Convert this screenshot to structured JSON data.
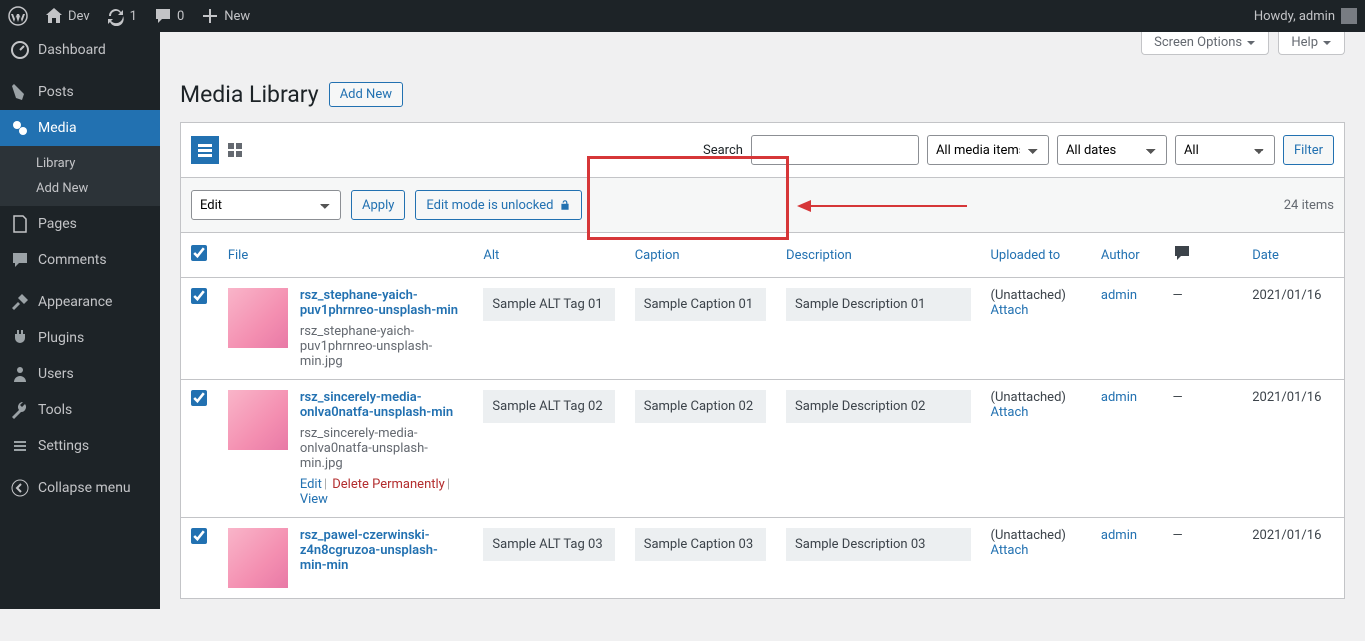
{
  "adminbar": {
    "site": "Dev",
    "updates": "1",
    "comments": "0",
    "new": "New",
    "howdy": "Howdy, admin"
  },
  "menu": {
    "dashboard": "Dashboard",
    "posts": "Posts",
    "media": "Media",
    "media_sub": {
      "library": "Library",
      "addnew": "Add New"
    },
    "pages": "Pages",
    "comments": "Comments",
    "appearance": "Appearance",
    "plugins": "Plugins",
    "users": "Users",
    "tools": "Tools",
    "settings": "Settings",
    "collapse": "Collapse menu"
  },
  "screen_meta": {
    "options": "Screen Options",
    "help": "Help"
  },
  "page": {
    "title": "Media Library",
    "add_new": "Add New"
  },
  "filters": {
    "search_label": "Search",
    "media_items": "All media items",
    "dates": "All dates",
    "all": "All",
    "filter": "Filter"
  },
  "bulk": {
    "action": "Edit",
    "apply": "Apply",
    "edit_mode": "Edit mode is unlocked",
    "count": "24 items"
  },
  "columns": {
    "file": "File",
    "alt": "Alt",
    "caption": "Caption",
    "description": "Description",
    "uploaded_to": "Uploaded to",
    "author": "Author",
    "date": "Date"
  },
  "rows": [
    {
      "title": "rsz_stephane-yaich-puv1phrnreo-unsplash-min",
      "filename": "rsz_stephane-yaich-puv1phrnreo-unsplash-min.jpg",
      "alt": "Sample ALT Tag 01",
      "caption": "Sample Caption 01",
      "description": "Sample Description 01",
      "uploaded": "(Unattached)",
      "attach": "Attach",
      "author": "admin",
      "comments": "—",
      "date": "2021/01/16",
      "show_actions": false
    },
    {
      "title": "rsz_sincerely-media-onlva0natfa-unsplash-min",
      "filename": "rsz_sincerely-media-onlva0natfa-unsplash-min.jpg",
      "alt": "Sample ALT Tag 02",
      "caption": "Sample Caption 02",
      "description": "Sample Description 02",
      "uploaded": "(Unattached)",
      "attach": "Attach",
      "author": "admin",
      "comments": "—",
      "date": "2021/01/16",
      "show_actions": true
    },
    {
      "title": "rsz_pawel-czerwinski-z4n8cgruzoa-unsplash-min-min",
      "filename": "",
      "alt": "Sample ALT Tag 03",
      "caption": "Sample Caption 03",
      "description": "Sample Description 03",
      "uploaded": "(Unattached)",
      "attach": "Attach",
      "author": "admin",
      "comments": "—",
      "date": "2021/01/16",
      "show_actions": false
    }
  ],
  "row_actions": {
    "edit": "Edit",
    "delete": "Delete Permanently",
    "view": "View"
  }
}
